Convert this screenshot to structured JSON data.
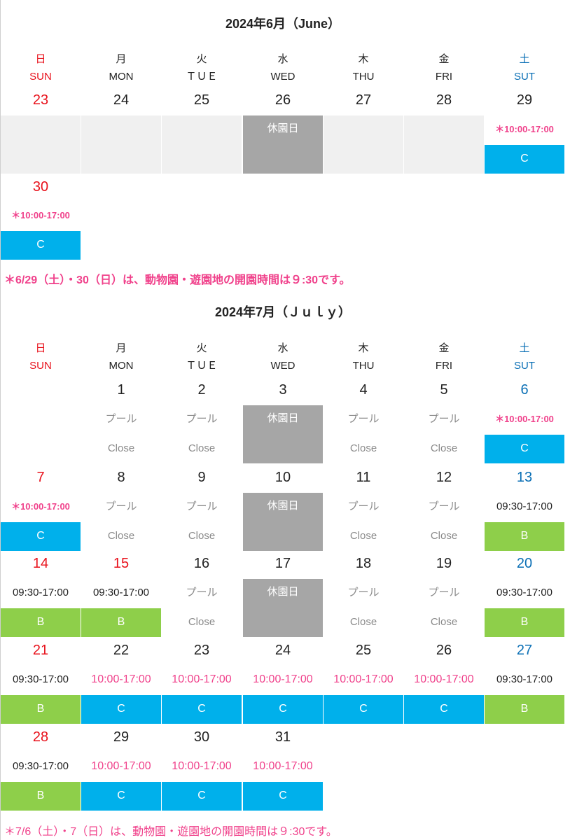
{
  "june": {
    "title": "2024年6月（June）",
    "weekdays": [
      {
        "jp": "日",
        "en": "SUN"
      },
      {
        "jp": "月",
        "en": "MON"
      },
      {
        "jp": "火",
        "en": "ＴＵＥ"
      },
      {
        "jp": "水",
        "en": "WED"
      },
      {
        "jp": "木",
        "en": "THU"
      },
      {
        "jp": "金",
        "en": "FRI"
      },
      {
        "jp": "土",
        "en": "SUT"
      }
    ],
    "days": [
      "23",
      "24",
      "25",
      "26",
      "27",
      "28",
      "29",
      "30"
    ],
    "closed_label": "休園日",
    "time_note": "＊10:00-17:00",
    "c_label": "C",
    "footnote": "＊6/29（土）・30（日）は、動物園・遊園地の開園時間は９:30です。"
  },
  "july": {
    "title": "2024年7月（Ｊｕｌｙ）",
    "weekdays": [
      {
        "jp": "日",
        "en": "SUN"
      },
      {
        "jp": "月",
        "en": "MON"
      },
      {
        "jp": "火",
        "en": "ＴＵＥ"
      },
      {
        "jp": "水",
        "en": "WED"
      },
      {
        "jp": "木",
        "en": "THU"
      },
      {
        "jp": "金",
        "en": "FRI"
      },
      {
        "jp": "土",
        "en": "SUT"
      }
    ],
    "days": [
      "1",
      "2",
      "3",
      "4",
      "5",
      "6",
      "7",
      "8",
      "9",
      "10",
      "11",
      "12",
      "13",
      "14",
      "15",
      "16",
      "17",
      "18",
      "19",
      "20",
      "21",
      "22",
      "23",
      "24",
      "25",
      "26",
      "27",
      "28",
      "29",
      "30",
      "31"
    ],
    "pool_label": "プール",
    "close_label": "Close",
    "closed_label": "休園日",
    "time_note": "＊10:00-17:00",
    "time_b": "09:30-17:00",
    "time_c": "10:00-17:00",
    "b_label": "B",
    "c_label": "C",
    "footnote": "＊7/6（土）・7（日）は、動物園・遊園地の開園時間は９:30です。"
  },
  "colors": {
    "sunday": "#e8111b",
    "saturday": "#0a6fb5",
    "pink": "#f0418b",
    "c_block": "#00b0eb",
    "b_block": "#8ecf4a",
    "closed_block": "#a6a6a6",
    "empty_block": "#f0f0f0"
  }
}
